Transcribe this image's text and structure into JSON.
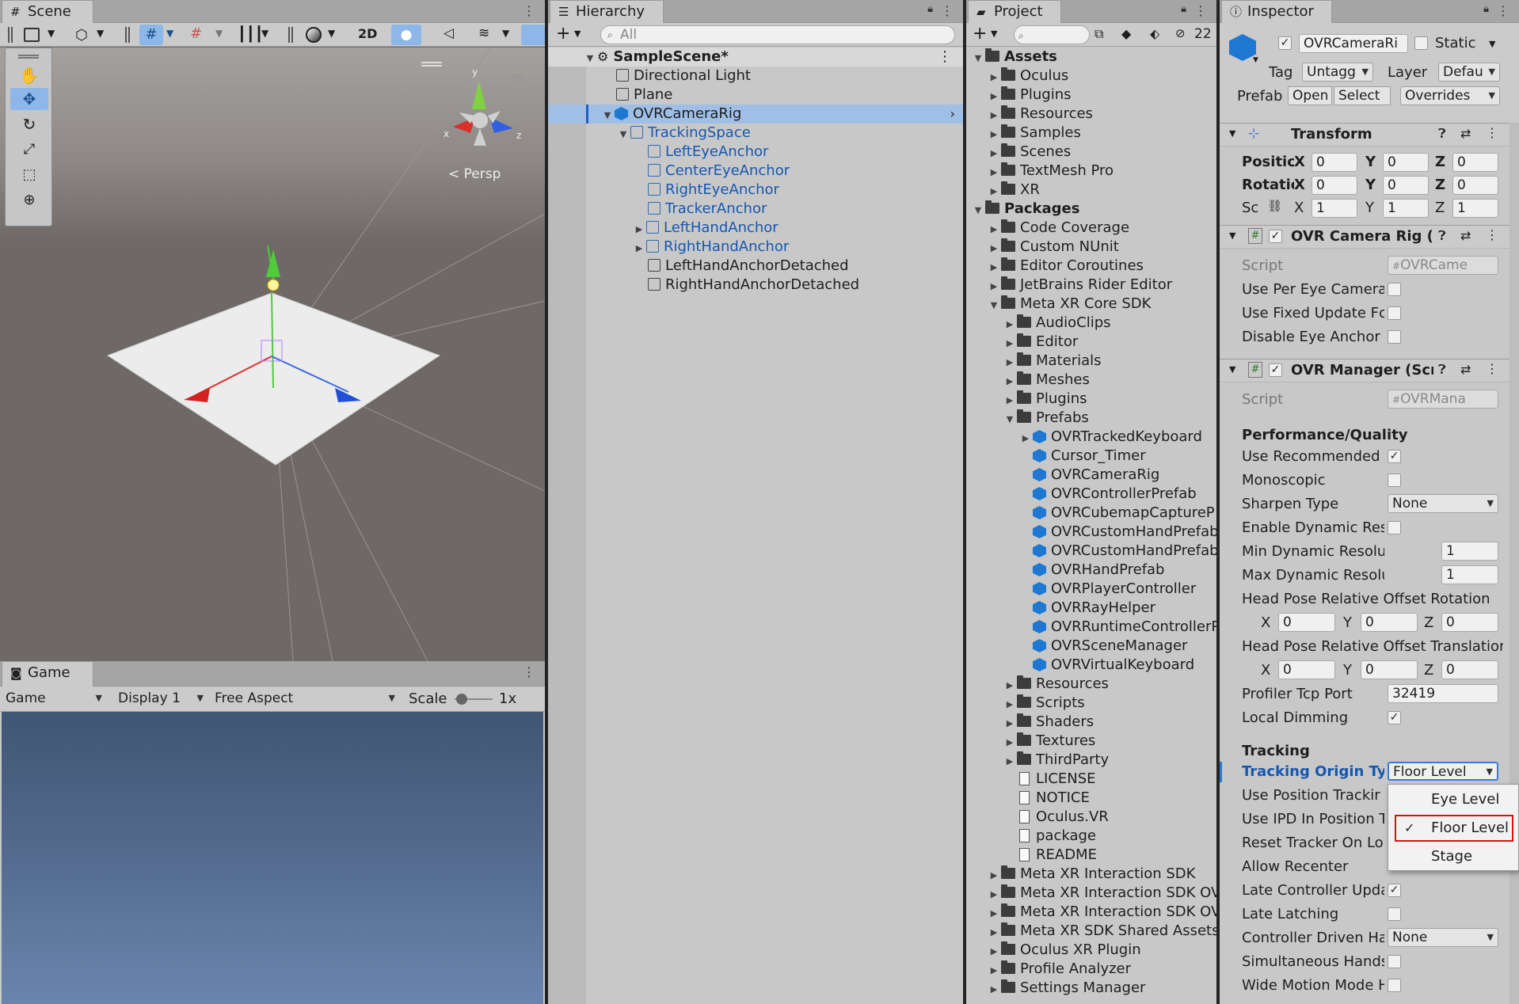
{
  "scene": {
    "tab_label": "Scene",
    "btn_2d": "2D",
    "persp_label": "Persp",
    "gizmo_y": "y",
    "gizmo_x": "x",
    "gizmo_z": "z"
  },
  "game": {
    "tab_label": "Game",
    "mode": "Game",
    "display": "Display 1",
    "aspect": "Free Aspect",
    "scale_label": "Scale",
    "scale_value": "1x"
  },
  "hierarchy": {
    "tab_label": "Hierarchy",
    "search_placeholder": "All",
    "items": [
      {
        "label": "SampleScene*"
      },
      {
        "label": "Directional Light"
      },
      {
        "label": "Plane"
      },
      {
        "label": "OVRCameraRig"
      },
      {
        "label": "TrackingSpace"
      },
      {
        "label": "LeftEyeAnchor"
      },
      {
        "label": "CenterEyeAnchor"
      },
      {
        "label": "RightEyeAnchor"
      },
      {
        "label": "TrackerAnchor"
      },
      {
        "label": "LeftHandAnchor"
      },
      {
        "label": "RightHandAnchor"
      },
      {
        "label": "LeftHandAnchorDetached"
      },
      {
        "label": "RightHandAnchorDetached"
      }
    ]
  },
  "project": {
    "tab_label": "Project",
    "hidden_count": "22",
    "items": [
      {
        "label": "Assets"
      },
      {
        "label": "Oculus"
      },
      {
        "label": "Plugins"
      },
      {
        "label": "Resources"
      },
      {
        "label": "Samples"
      },
      {
        "label": "Scenes"
      },
      {
        "label": "TextMesh Pro"
      },
      {
        "label": "XR"
      },
      {
        "label": "Packages"
      },
      {
        "label": "Code Coverage"
      },
      {
        "label": "Custom NUnit"
      },
      {
        "label": "Editor Coroutines"
      },
      {
        "label": "JetBrains Rider Editor"
      },
      {
        "label": "Meta XR Core SDK"
      },
      {
        "label": "AudioClips"
      },
      {
        "label": "Editor"
      },
      {
        "label": "Materials"
      },
      {
        "label": "Meshes"
      },
      {
        "label": "Plugins"
      },
      {
        "label": "Prefabs"
      },
      {
        "label": "OVRTrackedKeyboard"
      },
      {
        "label": "Cursor_Timer"
      },
      {
        "label": "OVRCameraRig"
      },
      {
        "label": "OVRControllerPrefab"
      },
      {
        "label": "OVRCubemapCaptureP"
      },
      {
        "label": "OVRCustomHandPrefab"
      },
      {
        "label": "OVRCustomHandPrefab"
      },
      {
        "label": "OVRHandPrefab"
      },
      {
        "label": "OVRPlayerController"
      },
      {
        "label": "OVRRayHelper"
      },
      {
        "label": "OVRRuntimeControllerP"
      },
      {
        "label": "OVRSceneManager"
      },
      {
        "label": "OVRVirtualKeyboard"
      },
      {
        "label": "Resources"
      },
      {
        "label": "Scripts"
      },
      {
        "label": "Shaders"
      },
      {
        "label": "Textures"
      },
      {
        "label": "ThirdParty"
      },
      {
        "label": "LICENSE"
      },
      {
        "label": "NOTICE"
      },
      {
        "label": "Oculus.VR"
      },
      {
        "label": "package"
      },
      {
        "label": "README"
      },
      {
        "label": "Meta XR Interaction SDK"
      },
      {
        "label": "Meta XR Interaction SDK OV"
      },
      {
        "label": "Meta XR Interaction SDK OV"
      },
      {
        "label": "Meta XR SDK Shared Assets"
      },
      {
        "label": "Oculus XR Plugin"
      },
      {
        "label": "Profile Analyzer"
      },
      {
        "label": "Settings Manager"
      }
    ]
  },
  "inspector": {
    "tab_label": "Inspector",
    "object_name": "OVRCameraRi",
    "static_label": "Static",
    "tag_label": "Tag",
    "tag_value": "Untagg",
    "layer_label": "Layer",
    "layer_value": "Defau",
    "prefab_label": "Prefab",
    "prefab_open": "Open",
    "prefab_select": "Select",
    "prefab_overrides": "Overrides",
    "transform": {
      "title": "Transform",
      "position_label": "Positic",
      "rotation_label": "Rotatic",
      "scale_label": "Sc",
      "x": "X",
      "y": "Y",
      "z": "Z",
      "pos": [
        "0",
        "0",
        "0"
      ],
      "rot": [
        "0",
        "0",
        "0"
      ],
      "scl": [
        "1",
        "1",
        "1"
      ]
    },
    "camera_rig": {
      "title": "OVR Camera Rig (S",
      "script_label": "Script",
      "script_value": "OVRCame",
      "fields": [
        "Use Per Eye Camera",
        "Use Fixed Update Fc",
        "Disable Eye Anchor"
      ]
    },
    "manager": {
      "title": "OVR Manager (Scr",
      "script_label": "Script",
      "script_value": "OVRMana",
      "section_perf": "Performance/Quality",
      "use_recommended": "Use Recommended I",
      "monoscopic": "Monoscopic",
      "sharpen_type": "Sharpen Type",
      "sharpen_value": "None",
      "enable_dynamic": "Enable Dynamic Res",
      "min_dynamic": "Min Dynamic Resolu",
      "min_dynamic_value": "1",
      "max_dynamic": "Max Dynamic Resolu",
      "max_dynamic_value": "1",
      "head_pose_rot": "Head Pose Relative Offset Rotation",
      "head_pose_trans": "Head Pose Relative Offset Translation",
      "hp_rot": [
        "0",
        "0",
        "0"
      ],
      "hp_trans": [
        "0",
        "0",
        "0"
      ],
      "profiler_port": "Profiler Tcp Port",
      "profiler_port_value": "32419",
      "local_dimming": "Local Dimming",
      "section_tracking": "Tracking",
      "tracking_origin": "Tracking Origin Typ",
      "tracking_origin_value": "Floor Level",
      "use_position_tracking": "Use Position Trackir",
      "use_ipd": "Use IPD In Position T",
      "reset_tracker": "Reset Tracker On Lo",
      "allow_recenter": "Allow Recenter",
      "late_controller": "Late Controller Upda",
      "late_latching": "Late Latching",
      "controller_driven": "Controller Driven Ha",
      "controller_driven_value": "None",
      "simultaneous_hands": "Simultaneous Hands",
      "wide_motion": "Wide Motion Mode H"
    },
    "dropdown_options": [
      "Eye Level",
      "Floor Level",
      "Stage"
    ],
    "dropdown_selected": "Floor Level"
  },
  "colors": {
    "selected_row": "#9fbfe6",
    "prefab_blue": "#1557b0",
    "highlight_red": "#e01010",
    "scene_sky": "#7b7571",
    "game_sky_top": "#3f5675",
    "game_sky_bottom": "#6a85ad"
  }
}
